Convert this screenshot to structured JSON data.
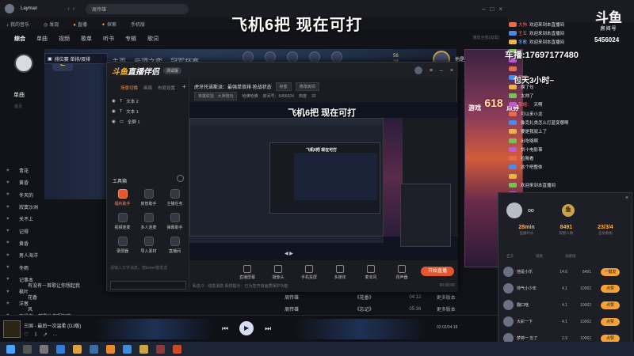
{
  "overlay": {
    "title": "飞机6把 现在可打",
    "phone": "车播:17697177480",
    "cheer": "包天3小时~",
    "room_label": "5456024"
  },
  "music": {
    "user": "Layman",
    "search_value": "周传雄",
    "subnav": [
      "我的音乐",
      "发现",
      "直播",
      "探索",
      "手机版"
    ],
    "tabs": [
      "综合",
      "单曲",
      "视频",
      "歌单",
      "听书",
      "专辑",
      "歌词"
    ],
    "tabs_right": "播放全部(如需)",
    "playlist_label": "排位赛 单排/双排",
    "sidebar_title": "单曲",
    "sidebar_sub": "首页",
    "sidebar_songs": [
      "青花",
      "黄昏",
      "冬天的",
      "寂寞沙洲",
      "关不上",
      "记得",
      "黄昏",
      "男人海洋",
      "冬雨",
      "记事本",
      "枫叶",
      "洋葱",
      "有没有一首歌让你想起我",
      "花香",
      "风"
    ],
    "banner_tabs": [
      "主页",
      "云顶之弈",
      "冠军杯赛"
    ],
    "banner_rank": [
      "56",
      "23"
    ],
    "banner_name": "他是小乐",
    "table": [
      {
        "title": "有没有一首歌让你想起我",
        "artist": "周传雄",
        "album": "《我在乎你》",
        "dur": "04:23",
        "more": "更多版本"
      },
      {
        "title": "花香",
        "artist": "周传雄",
        "album": "《花香》",
        "dur": "04:12",
        "more": "更多版本"
      },
      {
        "title": "风",
        "artist": "周传雄",
        "album": "《忘记》",
        "dur": "05:36",
        "more": "更多版本"
      }
    ],
    "player": {
      "song": "三国 - 最后一次温柔 (DJ版)",
      "time": "02:02/04:18"
    }
  },
  "obs": {
    "logo_a": "斗鱼",
    "logo_b": "直播伴侣",
    "version": "测试版",
    "scene_tabs": [
      "场景切换",
      "画面",
      "布局设置"
    ],
    "sources": [
      "文本 2",
      "文本 1",
      "全屏 1"
    ],
    "tools_title": "工具箱",
    "tools": [
      {
        "label": "福利助手",
        "hot": true
      },
      {
        "label": "房管助手",
        "hot": false
      },
      {
        "label": "主播任务",
        "hot": false
      },
      {
        "label": "视频连麦",
        "hot": false
      },
      {
        "label": "多人连麦",
        "hot": false
      },
      {
        "label": "弹幕助手",
        "hot": false
      },
      {
        "label": "录屏器",
        "hot": false
      },
      {
        "label": "导入素材",
        "hot": false
      },
      {
        "label": "直播间",
        "hot": false
      }
    ],
    "chat_hint": "请输入文字消息，按Enter键发送",
    "title_row": {
      "text": "虎牙托诺斯派：最强单双排 抢战状态",
      "tag1": "标签",
      "tag2": "修改房间"
    },
    "sub_row": {
      "t1": "英雄联盟 · 大神陪玩",
      "t2": "哈佛哈佛",
      "t3": "房间号：5456024",
      "t4": "热度",
      "t5": "32"
    },
    "preview_title": "飞机6把 现在可打",
    "preview_inner_title": "飞机6把 现在可打",
    "actions": [
      "直播屏幕",
      "摄像头",
      "手机投屏",
      "多媒体",
      "麦克风",
      "扬声器"
    ],
    "start_button": "开始直播",
    "status_left": "私信 0",
    "status_mid": "动态消息 系统提示：已为您开启画质保护功能",
    "status_time": "00:00:00"
  },
  "right": {
    "logo_big": "斗鱼",
    "logo_small": "房间号",
    "room": "5456024",
    "chat": [
      {
        "name": "大狗",
        "msg": "欢迎来到本直播间",
        "color": "r"
      },
      {
        "name": "王五",
        "msg": "欢迎来到本直播间",
        "color": "r"
      },
      {
        "name": "冬歌",
        "msg": "欢迎来到本直播间",
        "color": "b"
      },
      {
        "name": "",
        "msg": "",
        "color": "r"
      },
      {
        "name": "",
        "msg": "",
        "color": "r"
      },
      {
        "name": "",
        "msg": "",
        "color": "r"
      },
      {
        "name": "草帽：",
        "msg": "",
        "color": "r"
      },
      {
        "name": "",
        "msg": "换了句",
        "color": "g"
      },
      {
        "name": "",
        "msg": "太帅了",
        "color": "r"
      },
      {
        "name": "草帽：",
        "msg": "天啊",
        "color": "r"
      },
      {
        "name": "",
        "msg": "可以来小龙",
        "color": "r"
      },
      {
        "name": "",
        "msg": "像克扎类怎么打蓝变哪啊",
        "color": "b"
      },
      {
        "name": "",
        "msg": "要是我就上了",
        "color": "r"
      },
      {
        "name": "",
        "msg": "出吃咯啊",
        "color": "b"
      },
      {
        "name": "",
        "msg": "剑十电影事",
        "color": "r"
      },
      {
        "name": "",
        "msg": "拉胯看",
        "color": "r"
      },
      {
        "name": "",
        "msg": "这个吧整体",
        "color": "r"
      },
      {
        "name": "",
        "msg": "",
        "color": "r"
      },
      {
        "name": "",
        "msg": "欢迎来到本直播间",
        "color": "b"
      },
      {
        "name": "",
        "msg": "",
        "color": "r"
      }
    ],
    "rank": {
      "name": "oo",
      "badge": "鱼",
      "stats": [
        {
          "v": "28min",
          "l": "直播时长"
        },
        {
          "v": "8491",
          "l": "观看人数"
        },
        {
          "v": "23/3/4",
          "l": "击杀数据"
        }
      ],
      "head": [
        "名次",
        "观看",
        "贡献值"
      ],
      "rows": [
        {
          "name": "他是小乐",
          "a": "14.6",
          "b": "8491",
          "btn": "一键发"
        },
        {
          "name": "帅气小少年",
          "a": "4.1",
          "b": "10062",
          "btn": "点赞"
        },
        {
          "name": "翻口啥",
          "a": "4.1",
          "b": "10062",
          "btn": "点赞"
        },
        {
          "name": "大彩一下",
          "a": "4.1",
          "b": "10062",
          "btn": "点赞"
        },
        {
          "name": "梦婷一 忘了",
          "a": "2.9",
          "b": "10062",
          "btn": "点赞"
        }
      ],
      "footer": [
        "刷新排行榜",
        "查看完整排名(5)",
        "私人开房",
        "关闭"
      ]
    }
  },
  "colors": {
    "accent": "#e4572e",
    "gold": "#f2a43a"
  }
}
